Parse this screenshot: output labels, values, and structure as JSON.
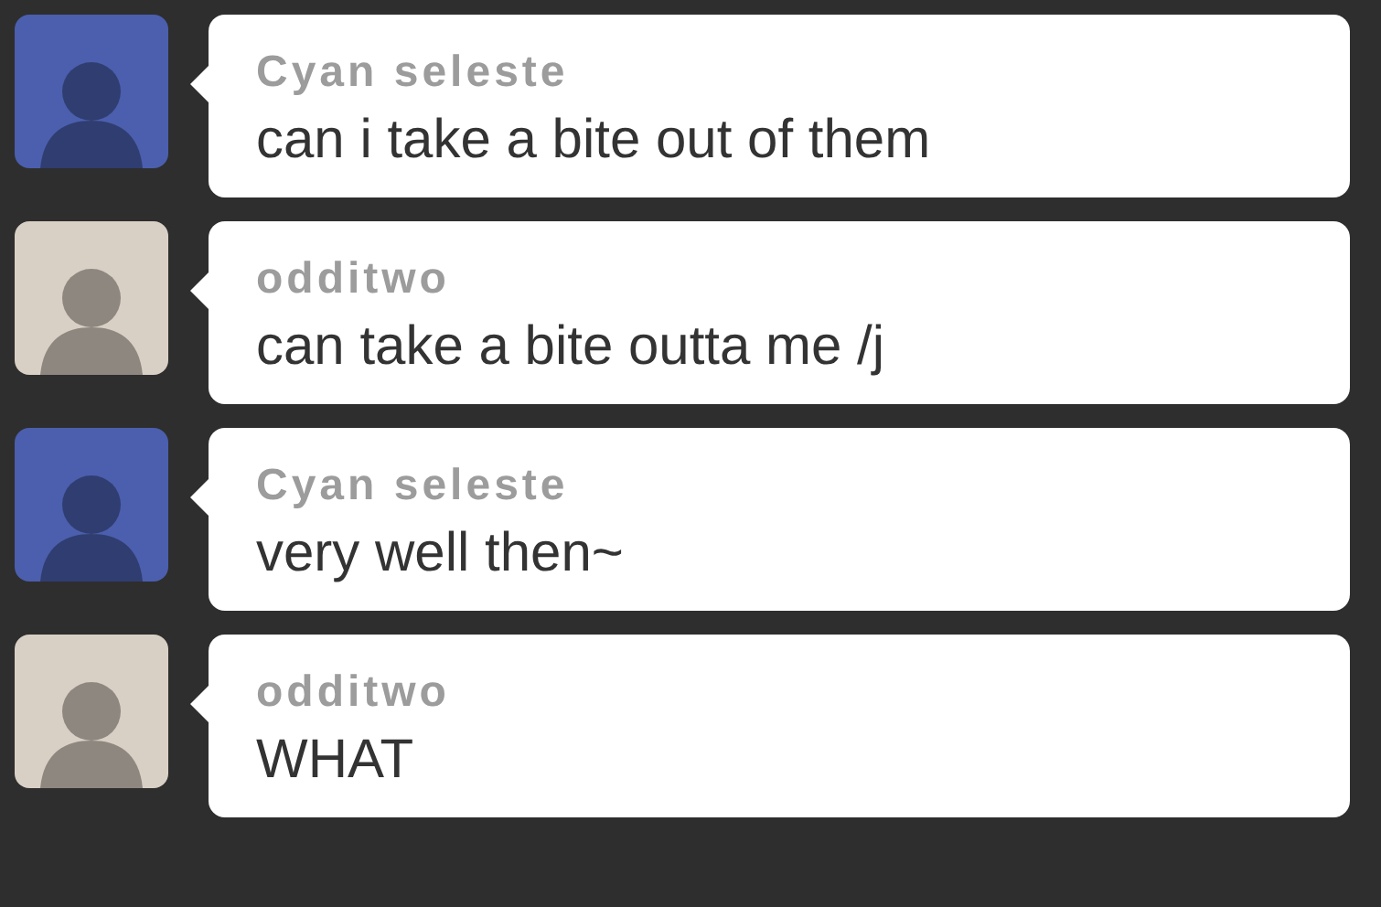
{
  "messages": [
    {
      "author": "Cyan seleste",
      "text": "can i take a bite out of them",
      "color": "#4b5fae"
    },
    {
      "author": "odditwo",
      "text": "can take a bite outta me /j",
      "color": "#d9d0c5"
    },
    {
      "author": "Cyan seleste",
      "text": "very well then~",
      "color": "#4b5fae"
    },
    {
      "author": "odditwo",
      "text": "WHAT",
      "color": "#d9d0c5"
    }
  ]
}
